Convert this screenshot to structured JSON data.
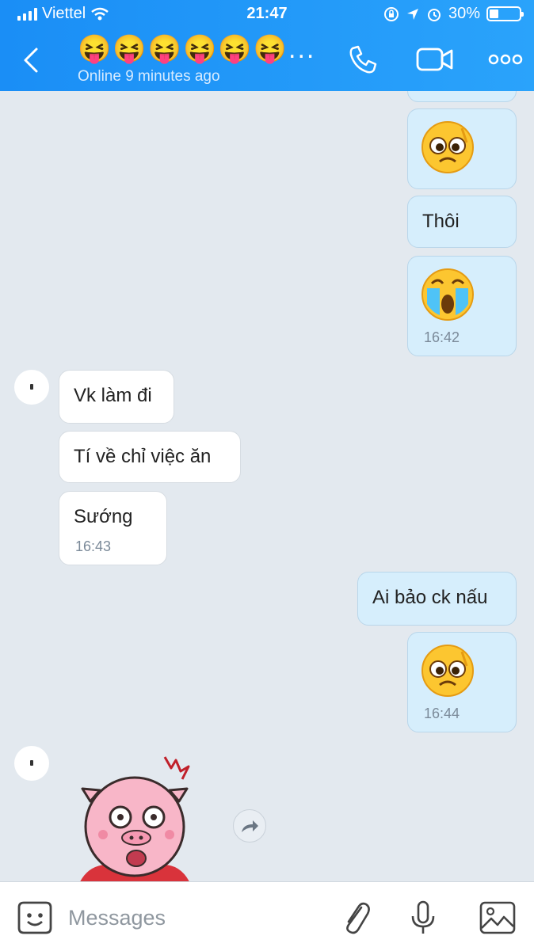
{
  "status_bar": {
    "carrier": "Viettel",
    "time": "21:47",
    "battery_percent": "30%",
    "battery_level": 0.3
  },
  "header": {
    "title": "😝😝😝😝😝😝...",
    "subtitle": "Online 9 minutes ago",
    "icons": [
      "back-icon",
      "phone-icon",
      "video-icon",
      "more-icon"
    ]
  },
  "messages": [
    {
      "side": "sent",
      "type": "emoji",
      "emoji": "pleading-face"
    },
    {
      "side": "sent",
      "type": "text",
      "text": "Thôi"
    },
    {
      "side": "sent",
      "type": "emoji",
      "emoji": "crying-face",
      "time": "16:42"
    },
    {
      "side": "received",
      "type": "text",
      "text": "Vk làm đi"
    },
    {
      "side": "received",
      "type": "text",
      "text": "Tí về chỉ việc ăn"
    },
    {
      "side": "received",
      "type": "text",
      "text": "Sướng",
      "time": "16:43"
    },
    {
      "side": "sent",
      "type": "text",
      "text": "Ai bảo ck nấu"
    },
    {
      "side": "sent",
      "type": "emoji",
      "emoji": "pleading-face",
      "time": "16:44"
    },
    {
      "side": "received",
      "type": "sticker",
      "sticker": "shocked-pig"
    }
  ],
  "composer": {
    "placeholder": "Messages",
    "icons": [
      "sticker-icon",
      "attachment-icon",
      "microphone-icon",
      "image-icon"
    ]
  },
  "colors": {
    "header": "#1a8ef6",
    "sent_bubble": "#d6eefc",
    "received_bubble": "#ffffff",
    "background": "#e3e9ef"
  }
}
